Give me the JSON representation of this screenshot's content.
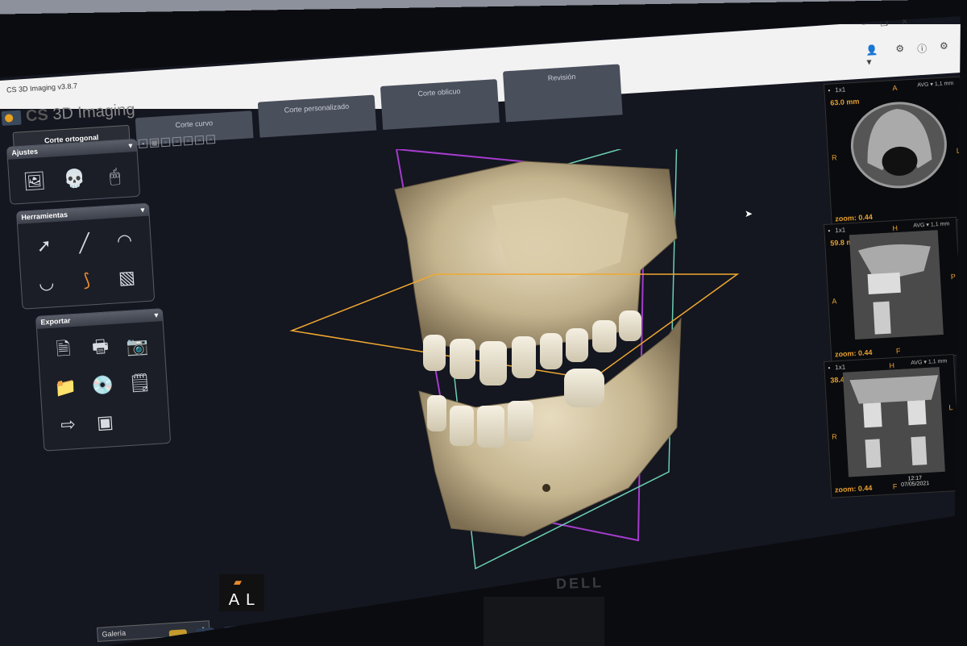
{
  "window": {
    "title": "CS 3D Imaging v3.8.7",
    "logo_brand": "CS",
    "logo_product": " 3D Imaging"
  },
  "tabs": [
    {
      "label": "Corte ortogonal"
    },
    {
      "label": "Corte curvo"
    },
    {
      "label": "Corte personalizado"
    },
    {
      "label": "Corte oblicuo"
    },
    {
      "label": "Revisión"
    }
  ],
  "panels": {
    "ajustes": {
      "title": "Ajustes",
      "icons": [
        "portrait-icon",
        "skull-icon",
        "mouse-icon"
      ]
    },
    "herramientas": {
      "title": "Herramientas",
      "icons": [
        "arrow-pointer-icon",
        "ruler-icon",
        "protractor-icon",
        "jaw-curve-icon",
        "nerve-canal-icon",
        "implant-icon"
      ]
    },
    "exportar": {
      "title": "Exportar",
      "icons": [
        "document-icon",
        "printer-icon",
        "camera-icon",
        "folder-icon",
        "cd-icon",
        "notes-icon",
        "export-skull-icon",
        "image-icon"
      ]
    }
  },
  "galeria": {
    "label": "Galería"
  },
  "orientation": {
    "left": "A",
    "right": "L"
  },
  "slices": [
    {
      "layout": "1x1",
      "mode": "AVG",
      "thickness": "1,1 mm",
      "position": "63.0 mm",
      "zoom": "zoom: 0.44",
      "labels": {
        "top": "A",
        "left": "R",
        "right": "L"
      }
    },
    {
      "layout": "1x1",
      "mode": "AVG",
      "thickness": "1,1 mm",
      "position": "59.8 mm",
      "zoom": "zoom: 0.44",
      "labels": {
        "top": "H",
        "left": "A",
        "right": "P",
        "bottom": "F"
      }
    },
    {
      "layout": "1x1",
      "mode": "AVG",
      "thickness": "1,1 mm",
      "position": "38.4 mm",
      "zoom": "zoom: 0.44",
      "labels": {
        "top": "H",
        "left": "R",
        "right": "L",
        "bottom": "F"
      }
    }
  ],
  "clock": {
    "time": "12:17",
    "date": "07/05/2021"
  },
  "monitor_brand": "DELL",
  "colors": {
    "axial_plane": "#f0a830",
    "sagittal_plane": "#a43ccc",
    "coronal_plane": "#6ad0b0",
    "accent": "#e8a030"
  }
}
